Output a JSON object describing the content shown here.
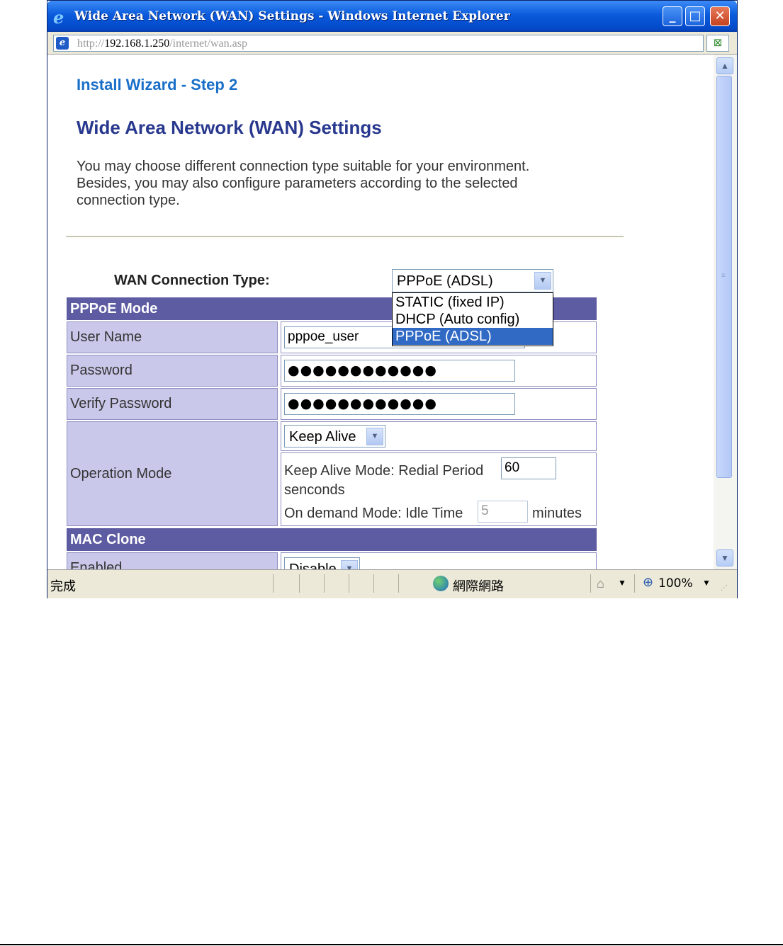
{
  "window": {
    "title": "Wide Area Network (WAN) Settings - Windows Internet Explorer",
    "controls": {
      "minimize": "_",
      "maximize": "□",
      "close": "✕"
    }
  },
  "address": {
    "scheme": "http://",
    "host": "192.168.1.250",
    "path": "/internet/wan.asp"
  },
  "page": {
    "wizard_step": "Install Wizard - Step 2",
    "heading": "Wide Area Network (WAN) Settings",
    "description_lines": [
      "You may choose different connection type suitable for your environment.",
      "Besides, you may also configure parameters according to the selected",
      "connection type."
    ],
    "wan_type_label": "WAN Connection Type:",
    "wan_type_selected": "PPPoE (ADSL)",
    "wan_type_options": [
      "STATIC (fixed IP)",
      "DHCP (Auto config)",
      "PPPoE (ADSL)"
    ]
  },
  "pppoe": {
    "section_title": "PPPoE Mode",
    "user_name_label": "User Name",
    "user_name_value": "pppoe_user",
    "password_label": "Password",
    "password_value": "●●●●●●●●●●●●",
    "verify_label": "Verify Password",
    "verify_value": "●●●●●●●●●●●●",
    "operation_label": "Operation Mode",
    "operation_selected": "Keep Alive",
    "keep_alive_text": "Keep Alive Mode: Redial Period",
    "keep_alive_value": "60",
    "keep_alive_unit": "senconds",
    "on_demand_text": "On demand Mode: Idle Time",
    "on_demand_value": "5",
    "on_demand_unit": "minutes"
  },
  "mac_clone": {
    "section_title": "MAC Clone",
    "enabled_label": "Enabled",
    "enabled_value": "Disable"
  },
  "status": {
    "text": "完成",
    "zone": "網際網路",
    "zoom": "100%"
  },
  "icons": {
    "ie": "e",
    "globe": "globe-icon",
    "zoom": "magnifier-icon"
  }
}
